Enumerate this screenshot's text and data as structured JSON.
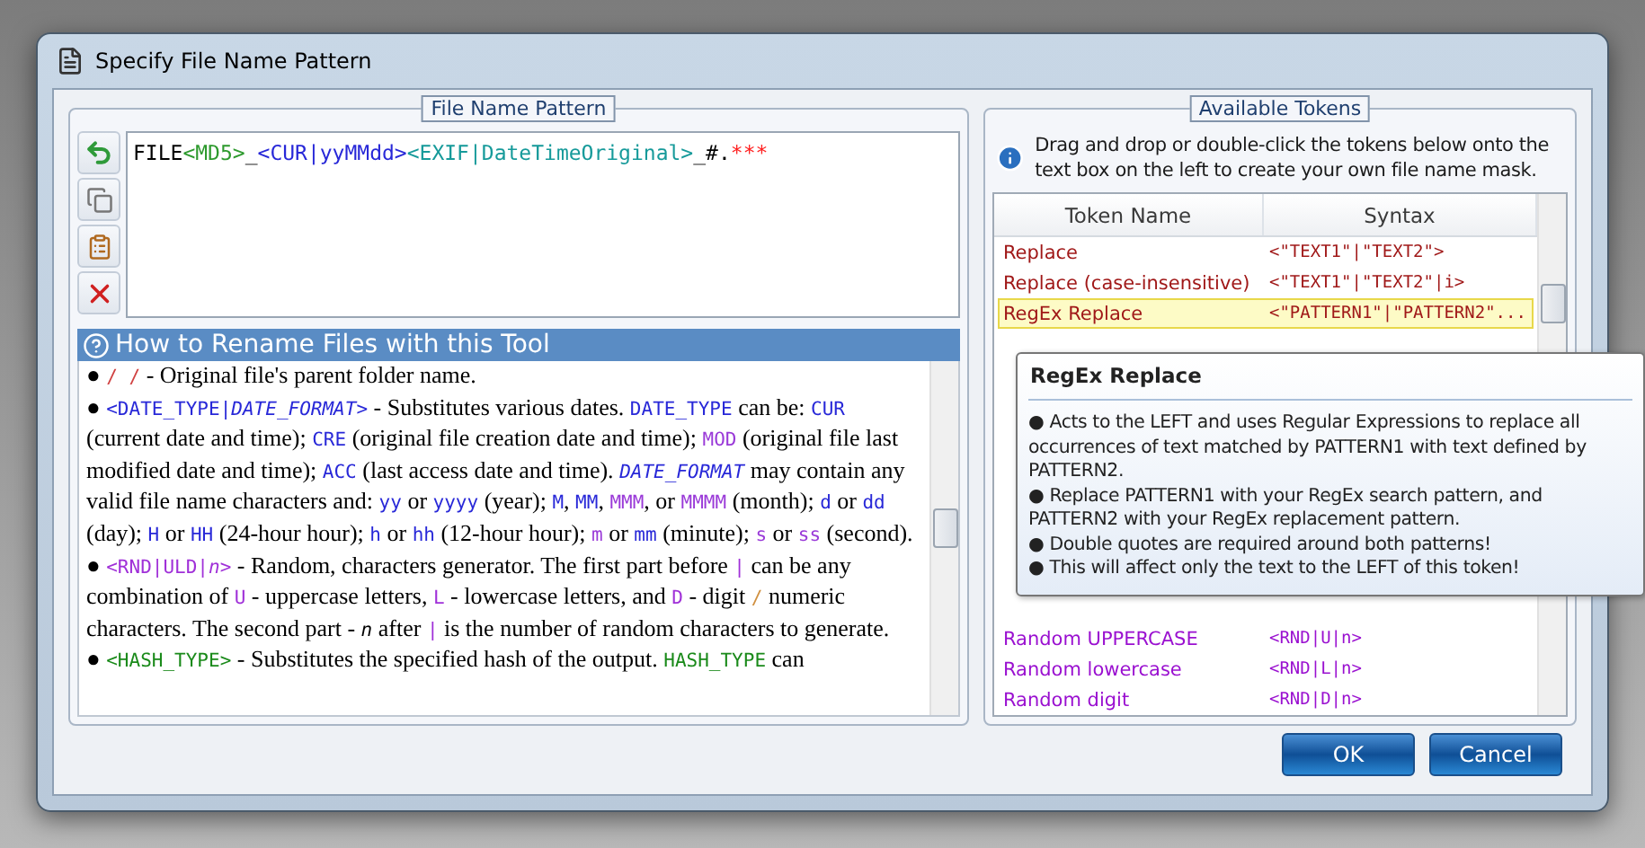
{
  "window": {
    "title": "Specify File Name Pattern"
  },
  "pattern_panel": {
    "title": "File Name Pattern",
    "pattern": [
      {
        "kind": "text",
        "text": "FILE"
      },
      {
        "kind": "token",
        "text": "<MD5>",
        "color": "#2e9a2e"
      },
      {
        "kind": "text",
        "text": "_"
      },
      {
        "kind": "token",
        "text": "<CUR|yyMMdd>",
        "color": "#2828d8"
      },
      {
        "kind": "token",
        "text": "<EXIF|DateTimeOriginal>",
        "color": "#169a9a"
      },
      {
        "kind": "text",
        "text": "_#."
      },
      {
        "kind": "token",
        "text": "***",
        "color": "#ff2020"
      }
    ]
  },
  "help": {
    "title": "How to Rename Files with this Tool",
    "paragraphs": [
      [
        {
          "kind": "text",
          "text": "● "
        },
        {
          "kind": "code",
          "text": "/ /",
          "color": "#d04040"
        },
        {
          "kind": "text",
          "text": " - Original file's parent folder name."
        }
      ],
      [
        {
          "kind": "text",
          "text": "● "
        },
        {
          "kind": "code",
          "text": "<DATE_TYPE|",
          "color": "#2828d8"
        },
        {
          "kind": "code_italic",
          "text": "DATE_FORMAT",
          "color": "#2828d8"
        },
        {
          "kind": "code",
          "text": ">",
          "color": "#2828d8"
        },
        {
          "kind": "text",
          "text": " - Substitutes various dates. "
        },
        {
          "kind": "code",
          "text": "DATE_TYPE",
          "color": "#2828d8"
        },
        {
          "kind": "text",
          "text": " can be: "
        },
        {
          "kind": "code",
          "text": "CUR",
          "color": "#2828d8"
        },
        {
          "kind": "text",
          "text": " (current date and time); "
        },
        {
          "kind": "code",
          "text": "CRE",
          "color": "#2828d8"
        },
        {
          "kind": "text",
          "text": " (original file creation date and time); "
        },
        {
          "kind": "code",
          "text": "MOD",
          "color": "#9a3ad8"
        },
        {
          "kind": "text",
          "text": " (original file last modified date and time); "
        },
        {
          "kind": "code",
          "text": "ACC",
          "color": "#2828d8"
        },
        {
          "kind": "text",
          "text": " (last access date and time). "
        },
        {
          "kind": "code_italic",
          "text": "DATE_FORMAT",
          "color": "#2828d8"
        },
        {
          "kind": "text",
          "text": " may contain any valid file name characters and: "
        },
        {
          "kind": "code",
          "text": "yy",
          "color": "#2828d8"
        },
        {
          "kind": "text",
          "text": " or "
        },
        {
          "kind": "code",
          "text": "yyyy",
          "color": "#2828d8"
        },
        {
          "kind": "text",
          "text": " (year); "
        },
        {
          "kind": "code",
          "text": "M",
          "color": "#2828d8"
        },
        {
          "kind": "text",
          "text": ", "
        },
        {
          "kind": "code",
          "text": "MM",
          "color": "#2828d8"
        },
        {
          "kind": "text",
          "text": ", "
        },
        {
          "kind": "code",
          "text": "MMM",
          "color": "#9a3ad8"
        },
        {
          "kind": "text",
          "text": ", or "
        },
        {
          "kind": "code",
          "text": "MMMM",
          "color": "#9a3ad8"
        },
        {
          "kind": "text",
          "text": " (month); "
        },
        {
          "kind": "code",
          "text": "d",
          "color": "#2828d8"
        },
        {
          "kind": "text",
          "text": " or "
        },
        {
          "kind": "code",
          "text": "dd",
          "color": "#2828d8"
        },
        {
          "kind": "text",
          "text": " (day); "
        },
        {
          "kind": "code",
          "text": "H",
          "color": "#2828d8"
        },
        {
          "kind": "text",
          "text": " or "
        },
        {
          "kind": "code",
          "text": "HH",
          "color": "#2828d8"
        },
        {
          "kind": "text",
          "text": " (24-hour hour); "
        },
        {
          "kind": "code",
          "text": "h",
          "color": "#2828d8"
        },
        {
          "kind": "text",
          "text": " or "
        },
        {
          "kind": "code",
          "text": "hh",
          "color": "#2828d8"
        },
        {
          "kind": "text",
          "text": " (12-hour hour); "
        },
        {
          "kind": "code",
          "text": "m",
          "color": "#9a3ad8"
        },
        {
          "kind": "text",
          "text": " or "
        },
        {
          "kind": "code",
          "text": "mm",
          "color": "#2828d8"
        },
        {
          "kind": "text",
          "text": " (minute); "
        },
        {
          "kind": "code",
          "text": "s",
          "color": "#9a3ad8"
        },
        {
          "kind": "text",
          "text": " or "
        },
        {
          "kind": "code",
          "text": "ss",
          "color": "#9a3ad8"
        },
        {
          "kind": "text",
          "text": " (second)."
        }
      ],
      [
        {
          "kind": "text",
          "text": "● "
        },
        {
          "kind": "code",
          "text": "<RND|ULD|",
          "color": "#a030d8"
        },
        {
          "kind": "code_italic",
          "text": "n",
          "color": "#a030d8"
        },
        {
          "kind": "code",
          "text": ">",
          "color": "#a030d8"
        },
        {
          "kind": "text",
          "text": " - Random, characters generator. The first part before "
        },
        {
          "kind": "code",
          "text": "|",
          "color": "#a030d8"
        },
        {
          "kind": "text",
          "text": " can be any combination of "
        },
        {
          "kind": "code",
          "text": "U",
          "color": "#a030d8"
        },
        {
          "kind": "text",
          "text": " - uppercase letters, "
        },
        {
          "kind": "code",
          "text": "L",
          "color": "#a030d8"
        },
        {
          "kind": "text",
          "text": " - lowercase letters, and "
        },
        {
          "kind": "code",
          "text": "D",
          "color": "#a030d8"
        },
        {
          "kind": "text",
          "text": " - digit "
        },
        {
          "kind": "code",
          "text": "/",
          "color": "#d09040"
        },
        {
          "kind": "text",
          "text": " numeric characters. The second part - "
        },
        {
          "kind": "code_italic",
          "text": "n",
          "color": "#000000"
        },
        {
          "kind": "text",
          "text": " after "
        },
        {
          "kind": "code",
          "text": "|",
          "color": "#a030d8"
        },
        {
          "kind": "text",
          "text": " is the number of random characters to generate."
        }
      ],
      [
        {
          "kind": "text",
          "text": "● "
        },
        {
          "kind": "code",
          "text": "<HASH_TYPE>",
          "color": "#1a8a1a"
        },
        {
          "kind": "text",
          "text": " - Substitutes the specified hash of the output. "
        },
        {
          "kind": "code",
          "text": "HASH_TYPE",
          "color": "#1a8a1a"
        },
        {
          "kind": "text",
          "text": " can"
        }
      ]
    ]
  },
  "tokens_panel": {
    "title": "Available Tokens",
    "info": "Drag and drop or double-click the tokens below onto the text box on the left to create your own file name mask.",
    "columns": [
      "Token Name",
      "Syntax"
    ],
    "rows_above": [
      {
        "name": "Replace",
        "syntax": "<\"TEXT1\"|\"TEXT2\">",
        "color": "#a01818",
        "selected": false
      },
      {
        "name": "Replace (case-insensitive)",
        "syntax": "<\"TEXT1\"|\"TEXT2\"|i>",
        "color": "#a01818",
        "selected": false
      },
      {
        "name": "RegEx Replace",
        "syntax": "<\"PATTERN1\"|\"PATTERN2\"...",
        "color": "#a01818",
        "selected": true
      }
    ],
    "rows_below": [
      {
        "name": "Random UPPERCASE",
        "syntax": "<RND|U|n>",
        "color": "#9a10d0",
        "selected": false
      },
      {
        "name": "Random lowercase",
        "syntax": "<RND|L|n>",
        "color": "#9a10d0",
        "selected": false
      },
      {
        "name": "Random digit",
        "syntax": "<RND|D|n>",
        "color": "#9a10d0",
        "selected": false
      }
    ]
  },
  "tooltip": {
    "title": "RegEx Replace",
    "lines": [
      "● Acts to the LEFT and uses Regular Expressions to replace all occurrences of text matched by PATTERN1 with text defined by PATTERN2.",
      "● Replace PATTERN1 with your RegEx search pattern, and PATTERN2 with your RegEx replacement pattern.",
      "● Double quotes are required around both patterns!",
      "● This will affect only the text to the LEFT of this token!"
    ]
  },
  "buttons": [
    "OK",
    "Cancel"
  ]
}
